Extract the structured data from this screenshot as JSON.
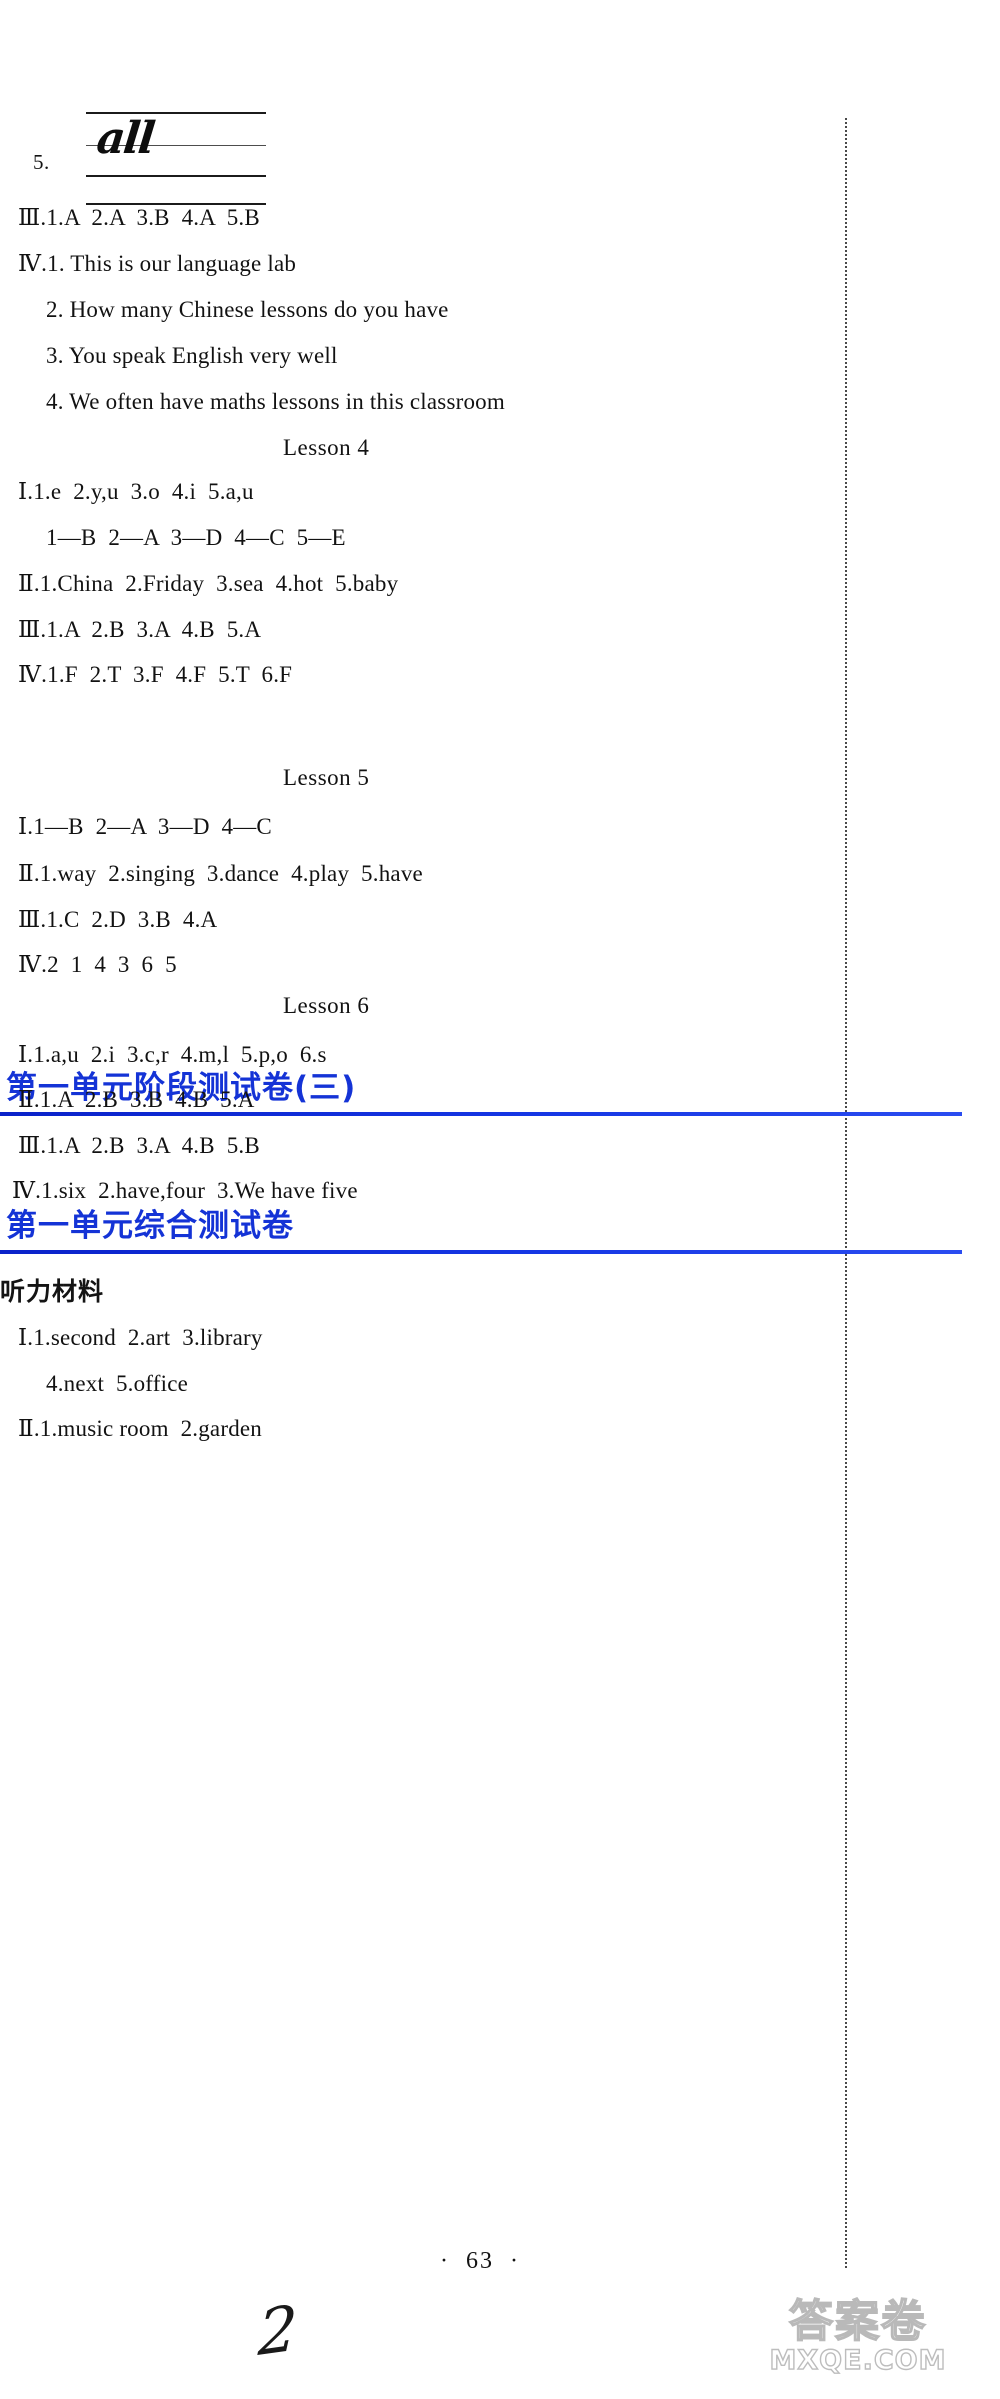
{
  "page": {
    "folio": "·  63  ·",
    "handwriting_scrawl": "2"
  },
  "handwriting_exercise": {
    "number": "5.",
    "word": "all"
  },
  "answers_top": [
    {
      "text": "Ⅲ.1.A  2.A  3.B  4.A  5.B"
    },
    {
      "text": "Ⅳ.1. This is our language lab"
    },
    {
      "text": "2. How many Chinese lessons do you have"
    },
    {
      "text": "3. You speak English very well"
    },
    {
      "text": "4. We often have maths lessons in this classroom"
    }
  ],
  "lesson4": {
    "heading": "Lesson 4",
    "answers": [
      {
        "text": "Ⅰ.1.e  2.y,u  3.o  4.i  5.a,u"
      },
      {
        "text": "1—B  2—A  3—D  4—C  5—E"
      },
      {
        "text": "Ⅱ.1.China  2.Friday  3.sea  4.hot  5.baby"
      },
      {
        "text": "Ⅲ.1.A  2.B  3.A  4.B  5.A"
      },
      {
        "text": "Ⅳ.1.F  2.T  3.F  4.F  5.T  6.F"
      }
    ]
  },
  "section_unit1_stage3": {
    "title": "第一单元阶段测试卷(三)"
  },
  "lesson5": {
    "heading": "Lesson 5",
    "answers": [
      {
        "text": "Ⅰ.1—B  2—A  3—D  4—C"
      },
      {
        "text": "Ⅱ.1.way  2.singing  3.dance  4.play  5.have"
      },
      {
        "text": "Ⅲ.1.C  2.D  3.B  4.A"
      },
      {
        "text": "Ⅳ.2  1  4  3  6  5"
      }
    ]
  },
  "lesson6": {
    "heading": "Lesson 6",
    "answers": [
      {
        "text": "Ⅰ.1.a,u  2.i  3.c,r  4.m,l  5.p,o  6.s"
      },
      {
        "text": "Ⅱ.1.A  2.B  3.B  4.B  5.A"
      },
      {
        "text": "Ⅲ.1.A  2.B  3.A  4.B  5.B"
      },
      {
        "text": "Ⅳ.1.six  2.have,four  3.We have five"
      }
    ]
  },
  "section_unit1_comprehensive": {
    "title": "第一单元综合测试卷",
    "subheading": "听力材料",
    "answers": [
      {
        "text": "Ⅰ.1.second  2.art  3.library"
      },
      {
        "text": "4.next  5.office"
      },
      {
        "text": "Ⅱ.1.music room  2.garden"
      }
    ]
  },
  "watermark": {
    "cn": "答案卷",
    "url": "MXQE.COM"
  },
  "colors": {
    "header_blue": "#1433d6",
    "rule_blue": "#1536e4",
    "text": "#121212"
  }
}
